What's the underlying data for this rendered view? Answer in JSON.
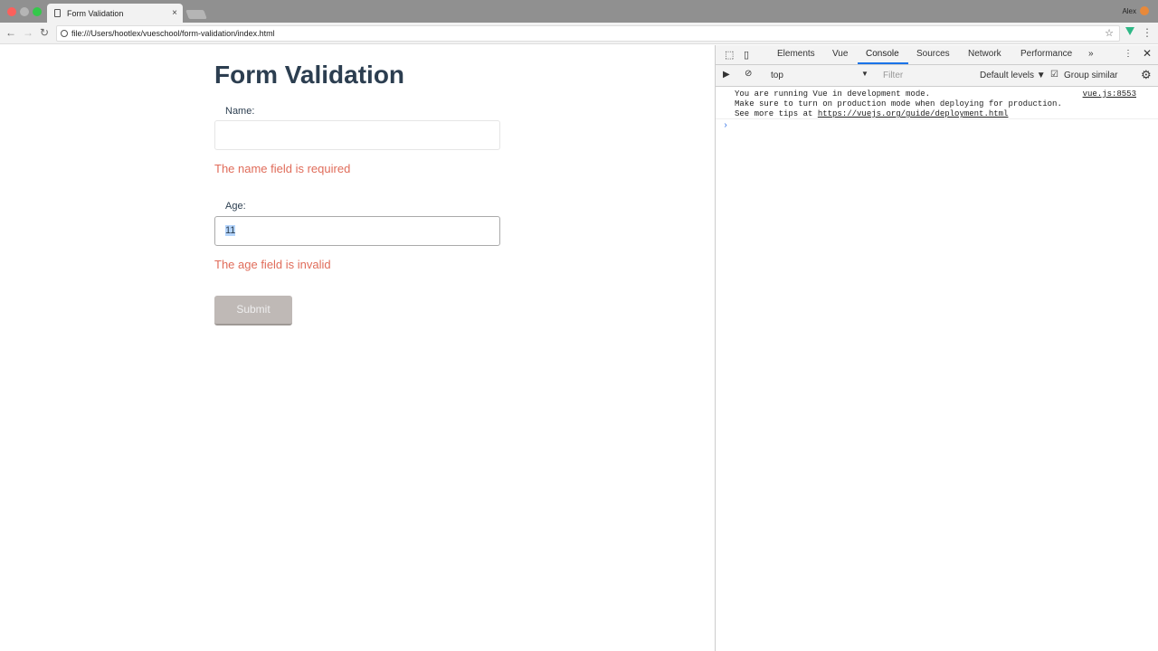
{
  "browser": {
    "tab_title": "Form Validation",
    "url": "file:///Users/hootlex/vueschool/form-validation/index.html",
    "user": "Alex"
  },
  "page": {
    "title": "Form Validation",
    "name_label": "Name:",
    "name_value": "",
    "name_error": "The name field is required",
    "age_label": "Age:",
    "age_value": "11",
    "age_error": "The age field is invalid",
    "submit_label": "Submit"
  },
  "devtools": {
    "tabs": [
      "Elements",
      "Vue",
      "Console",
      "Sources",
      "Network",
      "Performance"
    ],
    "active_tab": "Console",
    "context": "top",
    "filter_placeholder": "Filter",
    "levels": "Default levels ▼",
    "group_similar": "Group similar",
    "group_similar_checked": true,
    "message": {
      "line1": "You are running Vue in development mode.",
      "line2": "Make sure to turn on production mode when deploying for production.",
      "line3_prefix": "See more tips at ",
      "line3_link": "https://vuejs.org/guide/deployment.html",
      "source": "vue.js:8553"
    },
    "prompt": "›"
  }
}
